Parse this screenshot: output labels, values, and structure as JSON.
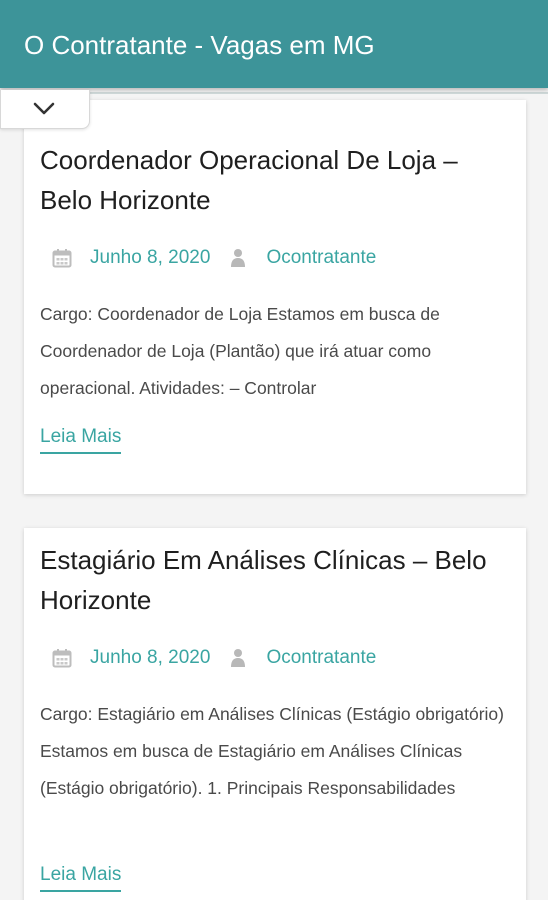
{
  "header": {
    "title": "O Contratante - Vagas em MG",
    "color": "#3d9499"
  },
  "toolbar": {
    "expand_icon": "chevron-down-icon"
  },
  "theme": {
    "accent": "#3aa5a2",
    "title_text": "#1f1f1f",
    "body_text": "#4a4a4a"
  },
  "posts": [
    {
      "title": "Coordenador Operacional De Loja – Belo Horizonte",
      "date": "Junho 8, 2020",
      "author": "Ocontratante",
      "date_icon": "calendar-icon",
      "author_icon": "user-icon",
      "excerpt": "Cargo: Coordenador de Loja Estamos em busca de Coordenador de Loja (Plantão) que irá atuar como operacional. Atividades: – Controlar",
      "read_more": "Leia Mais"
    },
    {
      "title": "Estagiário Em Análises Clínicas – Belo Horizonte",
      "date": "Junho 8, 2020",
      "author": "Ocontratante",
      "date_icon": "calendar-icon",
      "author_icon": "user-icon",
      "excerpt": "Cargo: Estagiário em Análises Clínicas (Estágio obrigatório) Estamos em busca de Estagiário em Análises Clínicas (Estágio obrigatório). 1. Principais Responsabilidades",
      "read_more": "Leia Mais"
    }
  ]
}
